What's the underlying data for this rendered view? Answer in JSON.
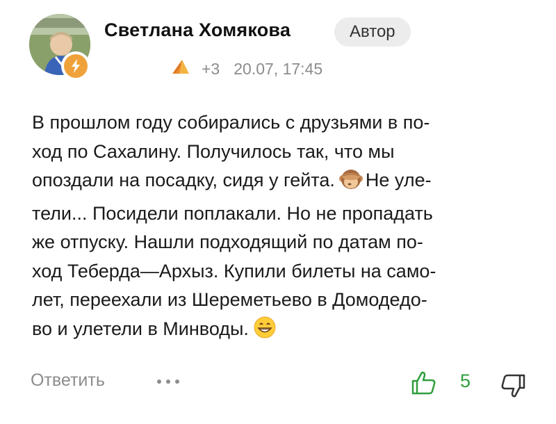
{
  "comment": {
    "author": {
      "name": "Светлана Хомякова",
      "badge": "Автор"
    },
    "meta": {
      "score": "+3",
      "date": "20.07, 17:45"
    },
    "text_lines": [
      "В прошлом году собирались с друзьями в по-",
      "ход по Сахалину. Получилось так, что мы",
      "опоздали на посадку, сидя у гейта.",
      "Не уле-",
      "тели... Посидели поплакали. Но не пропадать",
      "же отпуску. Нашли подходящий по датам по-",
      "ход Теберда—Архыз. Купили билеты на само-",
      "лет, переехали из Шереметьево в Домодедо-",
      "во и улетели в Минводы."
    ],
    "emojis": [
      "see-no-evil-monkey",
      "grinning-face"
    ],
    "footer": {
      "reply_label": "Ответить",
      "like_count": "5"
    }
  },
  "colors": {
    "accent_green": "#2e9e3c",
    "muted_gray": "#8c8c8c",
    "badge_bg": "#ececec",
    "badge_orange": "#f0a23a"
  }
}
